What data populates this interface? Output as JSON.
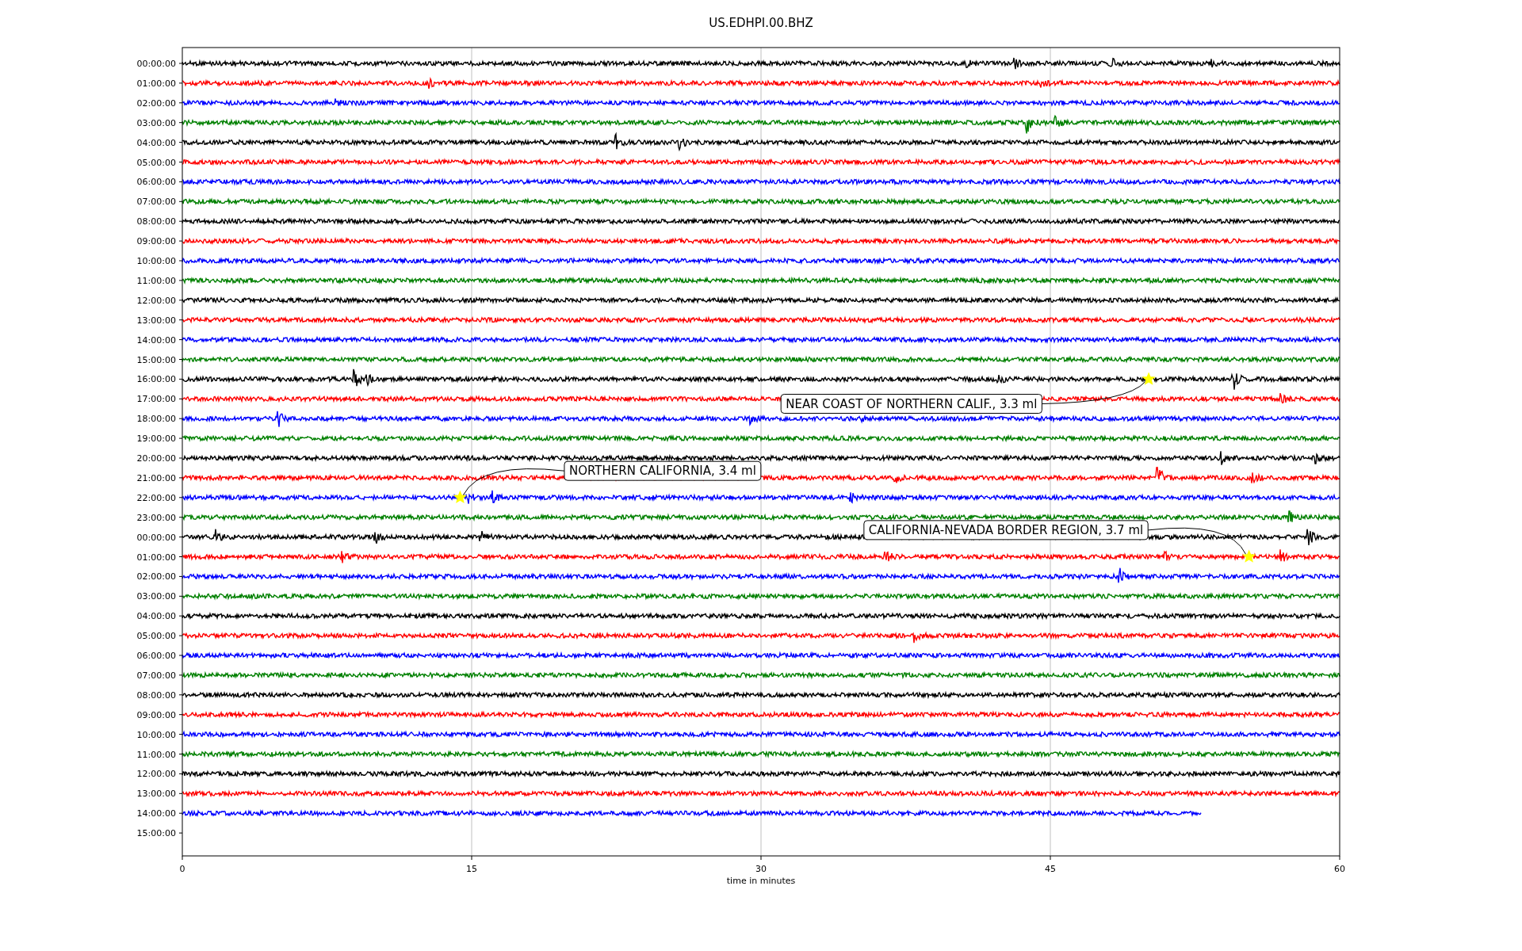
{
  "title": "US.EDHPI.00.BHZ",
  "chart": {
    "xlabel": "time in minutes",
    "xticks": [
      "0",
      "15",
      "30",
      "45",
      "60"
    ],
    "traces": [
      {
        "label": "00:00:00",
        "color": "#000000",
        "kind": "full"
      },
      {
        "label": "01:00:00",
        "color": "#ff0000",
        "kind": "full"
      },
      {
        "label": "02:00:00",
        "color": "#0000ff",
        "kind": "full"
      },
      {
        "label": "03:00:00",
        "color": "#008000",
        "kind": "full"
      },
      {
        "label": "04:00:00",
        "color": "#000000",
        "kind": "full"
      },
      {
        "label": "05:00:00",
        "color": "#ff0000",
        "kind": "full"
      },
      {
        "label": "06:00:00",
        "color": "#0000ff",
        "kind": "full"
      },
      {
        "label": "07:00:00",
        "color": "#008000",
        "kind": "full"
      },
      {
        "label": "08:00:00",
        "color": "#000000",
        "kind": "full"
      },
      {
        "label": "09:00:00",
        "color": "#ff0000",
        "kind": "full"
      },
      {
        "label": "10:00:00",
        "color": "#0000ff",
        "kind": "full"
      },
      {
        "label": "11:00:00",
        "color": "#008000",
        "kind": "full"
      },
      {
        "label": "12:00:00",
        "color": "#000000",
        "kind": "full"
      },
      {
        "label": "13:00:00",
        "color": "#ff0000",
        "kind": "full"
      },
      {
        "label": "14:00:00",
        "color": "#0000ff",
        "kind": "full"
      },
      {
        "label": "15:00:00",
        "color": "#008000",
        "kind": "full"
      },
      {
        "label": "16:00:00",
        "color": "#000000",
        "kind": "full",
        "event": {
          "label": "NEAR COAST OF NORTHERN CALIF., 3.3 ml"
        }
      },
      {
        "label": "17:00:00",
        "color": "#ff0000",
        "kind": "full"
      },
      {
        "label": "18:00:00",
        "color": "#0000ff",
        "kind": "full"
      },
      {
        "label": "19:00:00",
        "color": "#008000",
        "kind": "full"
      },
      {
        "label": "20:00:00",
        "color": "#000000",
        "kind": "full"
      },
      {
        "label": "21:00:00",
        "color": "#ff0000",
        "kind": "full"
      },
      {
        "label": "22:00:00",
        "color": "#0000ff",
        "kind": "full",
        "event": {
          "label": "NORTHERN CALIFORNIA, 3.4 ml"
        }
      },
      {
        "label": "23:00:00",
        "color": "#008000",
        "kind": "full"
      },
      {
        "label": "00:00:00",
        "color": "#000000",
        "kind": "full"
      },
      {
        "label": "01:00:00",
        "color": "#ff0000",
        "kind": "full",
        "event": {
          "label": "CALIFORNIA-NEVADA BORDER REGION, 3.7 ml"
        }
      },
      {
        "label": "02:00:00",
        "color": "#0000ff",
        "kind": "full"
      },
      {
        "label": "03:00:00",
        "color": "#008000",
        "kind": "full"
      },
      {
        "label": "04:00:00",
        "color": "#000000",
        "kind": "full"
      },
      {
        "label": "05:00:00",
        "color": "#ff0000",
        "kind": "full"
      },
      {
        "label": "06:00:00",
        "color": "#0000ff",
        "kind": "full"
      },
      {
        "label": "07:00:00",
        "color": "#008000",
        "kind": "full"
      },
      {
        "label": "08:00:00",
        "color": "#000000",
        "kind": "full"
      },
      {
        "label": "09:00:00",
        "color": "#ff0000",
        "kind": "full"
      },
      {
        "label": "10:00:00",
        "color": "#0000ff",
        "kind": "full"
      },
      {
        "label": "11:00:00",
        "color": "#008000",
        "kind": "full"
      },
      {
        "label": "12:00:00",
        "color": "#000000",
        "kind": "full"
      },
      {
        "label": "13:00:00",
        "color": "#ff0000",
        "kind": "full"
      },
      {
        "label": "14:00:00",
        "color": "#0000ff",
        "kind": "partial"
      },
      {
        "label": "15:00:00",
        "kind": "none"
      }
    ]
  }
}
